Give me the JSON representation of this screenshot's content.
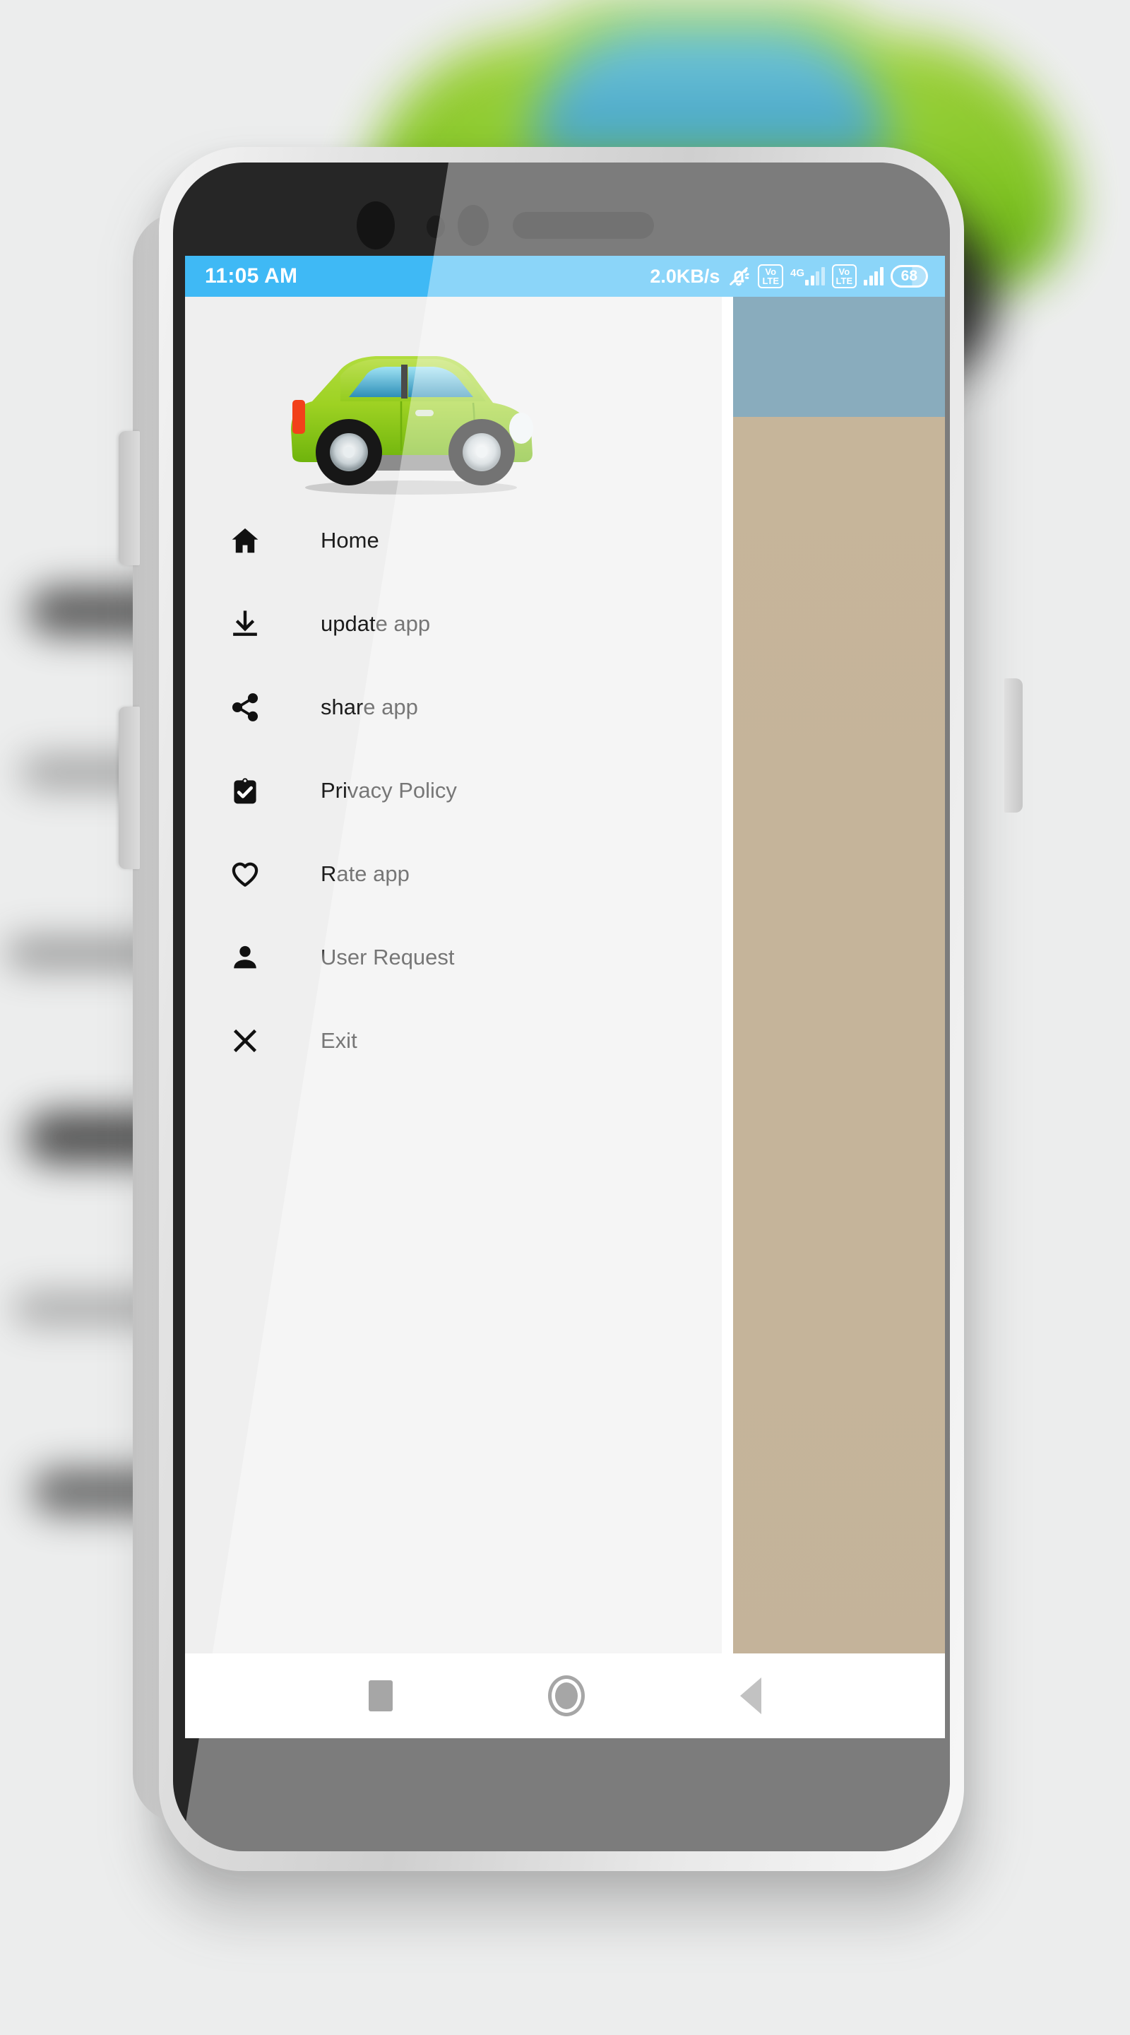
{
  "statusbar": {
    "clock": "11:05 AM",
    "network_speed": "2.0KB/s",
    "mute_icon": "bell-mute-icon",
    "volte_label_1": "Vo",
    "volte_label_2": "LTE",
    "network_type": "4G",
    "battery_level": "68"
  },
  "drawer": {
    "header_image": "green-car-illustration",
    "items": [
      {
        "icon": "home-icon",
        "label": "Home"
      },
      {
        "icon": "download-icon",
        "label": "update app"
      },
      {
        "icon": "share-icon",
        "label": "share app"
      },
      {
        "icon": "clipboard-check-icon",
        "label": "Privacy Policy"
      },
      {
        "icon": "heart-icon",
        "label": "Rate app"
      },
      {
        "icon": "person-icon",
        "label": "User Request"
      },
      {
        "icon": "close-icon",
        "label": "Exit"
      }
    ]
  },
  "panels": {
    "teal_color": "#3b7691",
    "tan_color": "#9d8157"
  },
  "navbar": {
    "recents": "recents-square",
    "home": "home-circle",
    "back": "back-triangle"
  },
  "theme": {
    "status_bar_color": "#3fb9f5",
    "drawer_bg": "#efefef",
    "text_color": "#1c1c1c"
  }
}
